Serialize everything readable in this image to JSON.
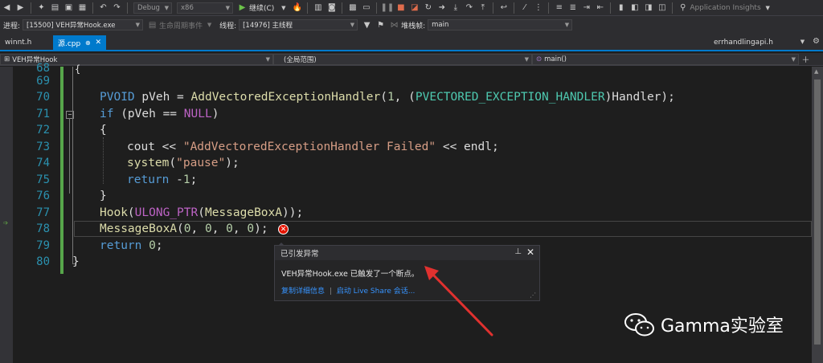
{
  "toolbar": {
    "config": "Debug",
    "platform": "x86",
    "continue_label": "继续(C)",
    "app_insights": "Application Insights"
  },
  "debugbar": {
    "process_label": "进程:",
    "process_value": "[15500] VEH异常Hook.exe",
    "lifecycle_label": "生命周期事件",
    "thread_label": "线程:",
    "thread_value": "[14976] 主线程",
    "stack_label": "堆栈帧:",
    "stack_value": "main"
  },
  "tabs": [
    {
      "label": "winnt.h"
    },
    {
      "label": "源.cpp"
    },
    {
      "label": "errhandlingapi.h"
    }
  ],
  "navbar": {
    "project": "VEH异常Hook",
    "scope": "(全局范围)",
    "function": "main()"
  },
  "code_lines": [
    {
      "num": "68"
    },
    {
      "num": "69"
    },
    {
      "num": "70"
    },
    {
      "num": "71"
    },
    {
      "num": "72"
    },
    {
      "num": "73"
    },
    {
      "num": "74"
    },
    {
      "num": "75"
    },
    {
      "num": "76"
    },
    {
      "num": "77"
    },
    {
      "num": "78"
    },
    {
      "num": "79"
    },
    {
      "num": "80"
    }
  ],
  "code": {
    "l70a": "PVOID",
    "l70b": " pVeh = ",
    "l70c": "AddVectoredExceptionHandler",
    "l70d": "(",
    "l70e": "1",
    "l70f": ", (",
    "l70g": "PVECTORED_EXCEPTION_HANDLER",
    "l70h": ")Handler);",
    "l71a": "if",
    "l71b": " (pVeh == ",
    "l71c": "NULL",
    "l71d": ")",
    "l72": "{",
    "l73a": "cout << ",
    "l73b": "\"AddVectoredExceptionHandler Failed\"",
    "l73c": " << endl;",
    "l74a": "system",
    "l74b": "(",
    "l74c": "\"pause\"",
    "l74d": ");",
    "l75a": "return",
    "l75b": " -",
    "l75c": "1",
    "l75d": ";",
    "l76": "}",
    "l77a": "Hook",
    "l77b": "(",
    "l77c": "ULONG_PTR",
    "l77d": "(",
    "l77e": "MessageBoxA",
    "l77f": "));",
    "l78a": "MessageBoxA",
    "l78b": "(",
    "l78c": "0",
    "l78d": ", ",
    "l78e": "0",
    "l78f": ", ",
    "l78g": "0",
    "l78h": ", ",
    "l78i": "0",
    "l78j": ");",
    "l79a": "return",
    "l79b": " ",
    "l79c": "0",
    "l79d": ";",
    "l80": "}"
  },
  "exception_popup": {
    "title": "已引发异常",
    "message": "VEH异常Hook.exe 已触发了一个断点。",
    "link_copy": "复制详细信息",
    "link_separator": "|",
    "link_liveshare": "启动 Live Share 会话..."
  },
  "watermark": {
    "text": "Gamma实验室"
  },
  "colors": {
    "accent": "#007acc",
    "error_icon": "#e51400",
    "arrow": "#e0312f",
    "line_number": "#2b91af",
    "change_bar": "#57a64a"
  }
}
